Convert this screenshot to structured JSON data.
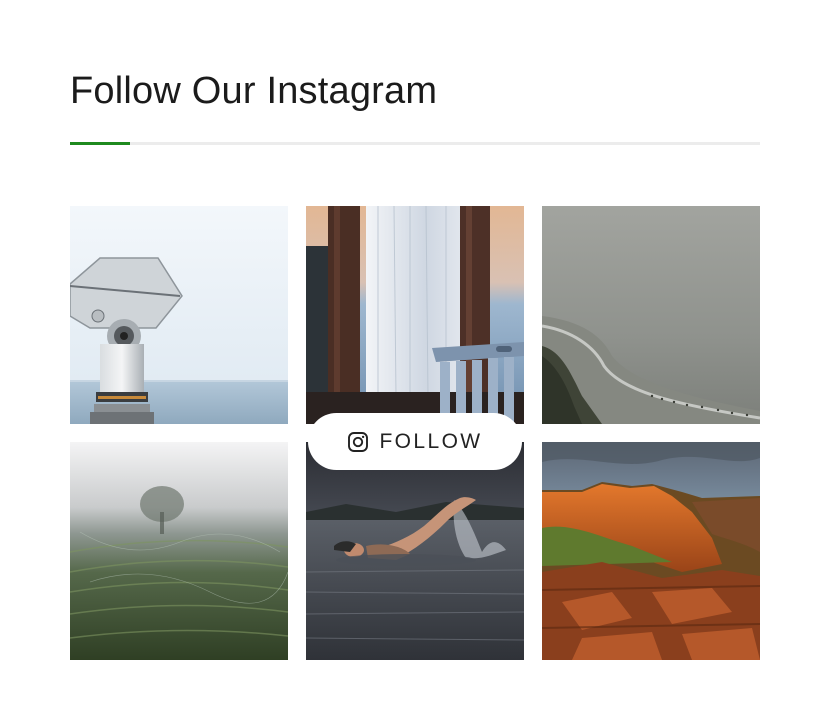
{
  "section": {
    "title": "Follow Our Instagram"
  },
  "follow_button": {
    "label": "FOLLOW",
    "icon": "instagram-icon"
  },
  "accent_color": "#1f8a1f",
  "gallery": [
    {
      "subject": "binocular-viewer-by-sea"
    },
    {
      "subject": "window-with-chair"
    },
    {
      "subject": "foggy-coastline"
    },
    {
      "subject": "misty-green-field"
    },
    {
      "subject": "swimmer-in-lake"
    },
    {
      "subject": "red-rock-canyon-sunset"
    }
  ]
}
